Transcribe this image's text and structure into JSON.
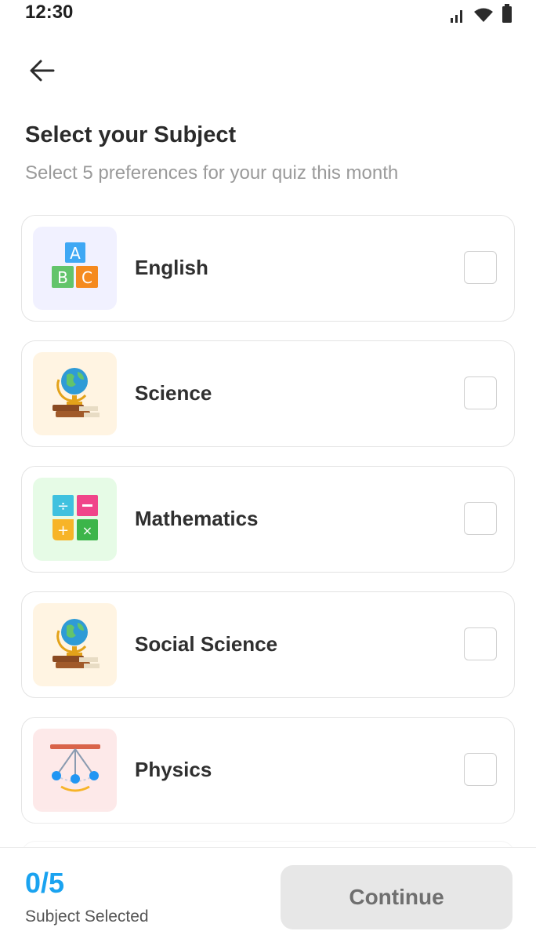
{
  "status_bar": {
    "time": "12:30",
    "icons": [
      "signal-icon",
      "wifi-icon",
      "battery-icon"
    ]
  },
  "header": {
    "back_icon": "back-arrow-icon",
    "title": "Select your Subject",
    "subtitle": "Select 5 preferences for your quiz this month"
  },
  "subjects": [
    {
      "label": "English",
      "icon": "abc-blocks-icon",
      "tile_color": "#f1f1ff",
      "checked": false
    },
    {
      "label": "Science",
      "icon": "globe-books-icon",
      "tile_color": "#fff4e2",
      "checked": false
    },
    {
      "label": "Mathematics",
      "icon": "math-operators-icon",
      "tile_color": "#e6fbe6",
      "checked": false
    },
    {
      "label": "Social Science",
      "icon": "globe-books-icon",
      "tile_color": "#fff4e2",
      "checked": false
    },
    {
      "label": "Physics",
      "icon": "pendulum-icon",
      "tile_color": "#fde9e9",
      "checked": false
    }
  ],
  "footer": {
    "count": "0/5",
    "count_label": "Subject Selected",
    "continue_label": "Continue"
  },
  "colors": {
    "accent": "#1aa3f0",
    "button_disabled": "#e7e7e7"
  }
}
